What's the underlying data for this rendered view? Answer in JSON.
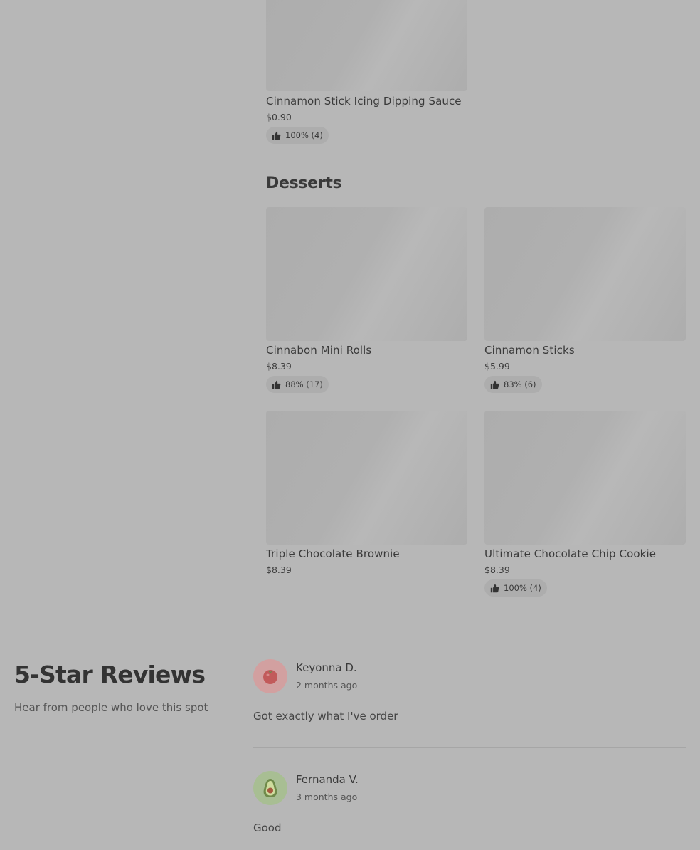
{
  "top_item": {
    "name": "Cinnamon Stick Icing Dipping Sauce",
    "price": "$0.90",
    "rating": "100% (4)"
  },
  "desserts": {
    "title": "Desserts",
    "items": [
      {
        "name": "Cinnabon Mini Rolls",
        "price": "$8.39",
        "rating": "88% (17)"
      },
      {
        "name": "Cinnamon Sticks",
        "price": "$5.99",
        "rating": "83% (6)"
      },
      {
        "name": "Triple Chocolate Brownie",
        "price": "$8.39",
        "rating": null
      },
      {
        "name": "Ultimate Chocolate Chip Cookie",
        "price": "$8.39",
        "rating": "100% (4)"
      }
    ]
  },
  "reviews": {
    "title": "5-Star Reviews",
    "subtitle": "Hear from people who love this spot",
    "items": [
      {
        "name": "Keyonna D.",
        "time": "2 months ago",
        "text": "Got exactly what I've order",
        "avatar_icon": "tomato-icon",
        "avatar_color": "#d7a2a2"
      },
      {
        "name": "Fernanda V.",
        "time": "3 months ago",
        "text": "Good",
        "avatar_icon": "avocado-icon",
        "avatar_color": "#a9bf94"
      }
    ]
  },
  "colors": {
    "overlay_bg": "#b7b7b7",
    "image_placeholder": "#adadad",
    "rating_pill": "#adadad"
  }
}
